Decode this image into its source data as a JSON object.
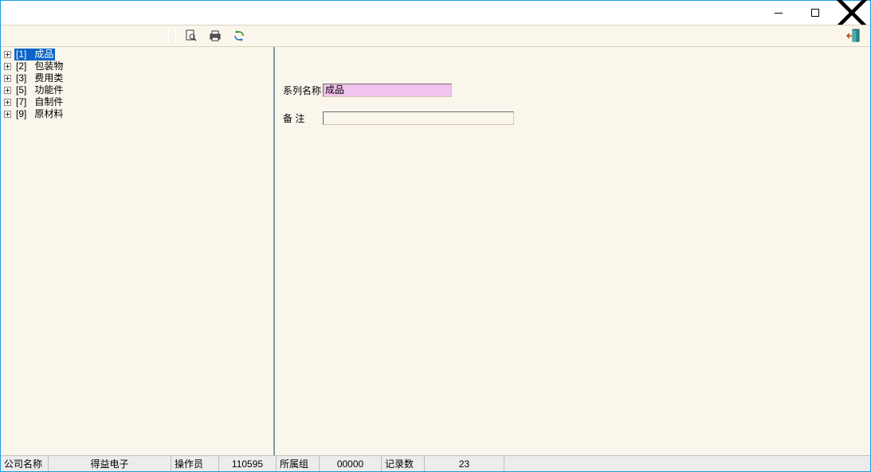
{
  "tree": {
    "items": [
      {
        "code": "[1]",
        "name": "成品",
        "selected": true
      },
      {
        "code": "[2]",
        "name": "包装物",
        "selected": false
      },
      {
        "code": "[3]",
        "name": "费用类",
        "selected": false
      },
      {
        "code": "[5]",
        "name": "功能件",
        "selected": false
      },
      {
        "code": "[7]",
        "name": "自制件",
        "selected": false
      },
      {
        "code": "[9]",
        "name": "原材料",
        "selected": false
      }
    ]
  },
  "form": {
    "series_label": "系列名称",
    "series_value": "成品",
    "remark_label": "备    注",
    "remark_value": ""
  },
  "status": {
    "company_label": "公司名称",
    "company_value": "得益电子",
    "operator_label": "操作员",
    "operator_value": "110595",
    "group_label": "所属组",
    "group_value": "00000",
    "recordcount_label": "记录数",
    "recordcount_value": "23"
  }
}
